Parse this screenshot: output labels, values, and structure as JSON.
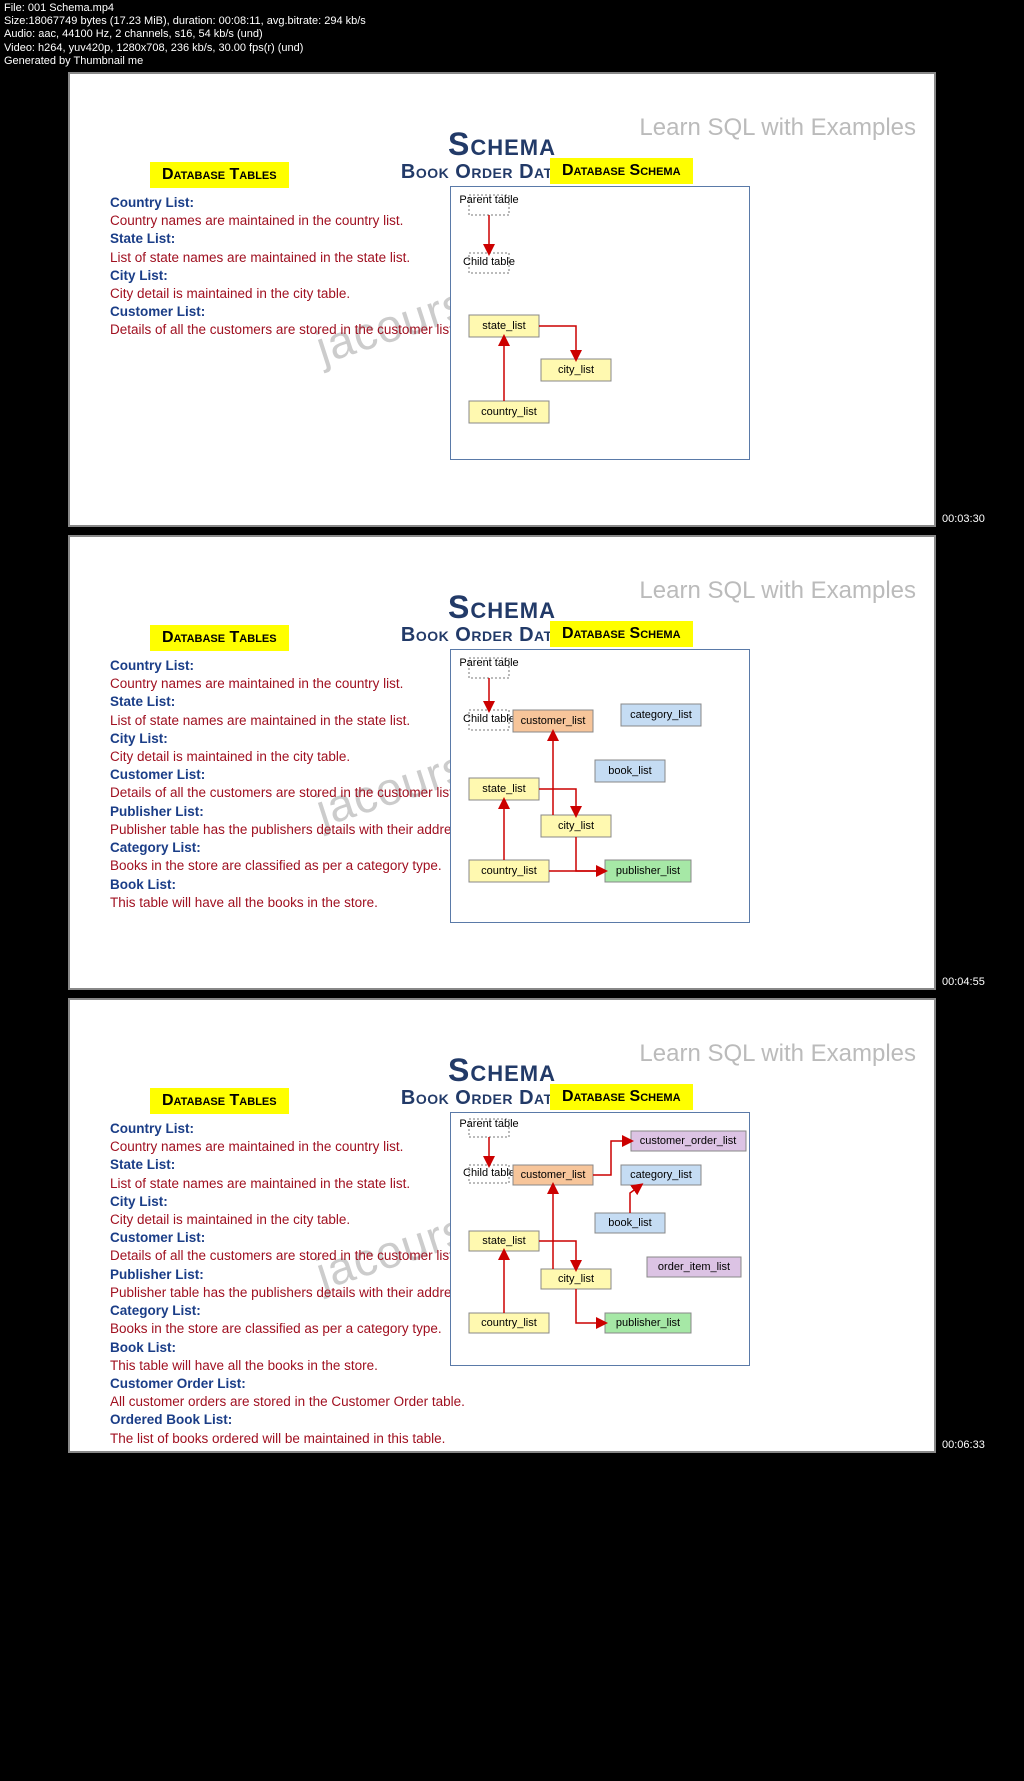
{
  "meta": {
    "file_line": "File: 001 Schema.mp4",
    "size_line": "Size:18067749 bytes (17.23 MiB), duration: 00:08:11, avg.bitrate: 294 kb/s",
    "audio_line": "Audio: aac, 44100 Hz, 2 channels, s16, 54 kb/s (und)",
    "video_line": "Video: h264, yuv420p, 1280x708, 236 kb/s, 30.00 fps(r) (und)",
    "gen_line": "Generated by Thumbnail me"
  },
  "common": {
    "watermark_tag": "Learn SQL with Examples",
    "watermark_diag": "jacourses.com",
    "title": "Schema",
    "subtitle": "Book Order Database",
    "pill_left": "Database Tables",
    "pill_right": "Database Schema",
    "parent_table": "Parent table",
    "child_table": "Child table"
  },
  "defs": {
    "country_h": "Country List:",
    "country_b": "Country names are maintained in the country list.",
    "state_h": "State List:",
    "state_b": "List of state names are maintained in the state list.",
    "city_h": "City List:",
    "city_b": "City detail is maintained in the city table.",
    "customer_h": "Customer List:",
    "customer_b": "Details of all the customers are stored in the customer list.",
    "publisher_h": "Publisher List:",
    "publisher_b": "Publisher table has the publishers details with their address.",
    "category_h": "Category List:",
    "category_b": "Books in the store are classified as per a category type.",
    "book_h": "Book List:",
    "book_b": "This table will have all the books in the store.",
    "custorder_h": "Customer Order List:",
    "custorder_b": "All customer orders are stored in the Customer Order table.",
    "orderedbook_h": "Ordered Book List:",
    "orderedbook_b": "The list of books ordered will be maintained in this table."
  },
  "nodes": {
    "state_list": "state_list",
    "city_list": "city_list",
    "country_list": "country_list",
    "customer_list": "customer_list",
    "category_list": "category_list",
    "book_list": "book_list",
    "publisher_list": "publisher_list",
    "customer_order_list": "customer_order_list",
    "order_item_list": "order_item_list"
  },
  "ts": {
    "t1": "00:03:30",
    "t2": "00:04:55",
    "t3": "00:06:33"
  }
}
